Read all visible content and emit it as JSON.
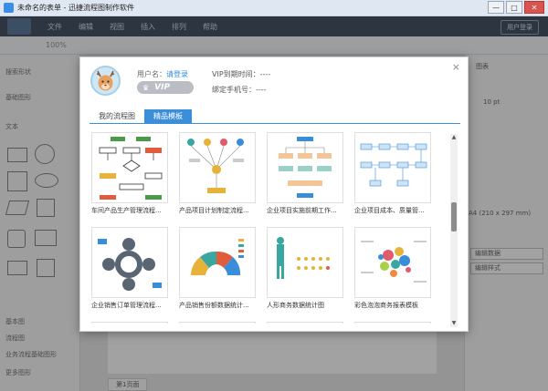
{
  "window": {
    "title": "未命名的表单 - 迅捷流程图制作软件",
    "minimize": "—",
    "maximize": "□",
    "close": "✕"
  },
  "menu": {
    "items": [
      "文件",
      "编辑",
      "视图",
      "插入",
      "排列",
      "帮助"
    ],
    "login_button": "用户登录"
  },
  "toolbar": {
    "zoom": "100%"
  },
  "left_panel": {
    "search_placeholder": "搜索形状",
    "section_basic": "基础图形",
    "text_label": "文本",
    "section_more": [
      "基本图",
      "流程图",
      "业务流程基础图形"
    ],
    "more_button": "更多图形"
  },
  "canvas": {
    "page_tab": "第1页面"
  },
  "right_panel": {
    "label_top": "图表",
    "size_text": "10 pt",
    "paper": "A4 (210 x 297 mm)",
    "btn1": "编辑数据",
    "btn2": "编辑样式"
  },
  "modal": {
    "close": "×",
    "username_label": "用户名：",
    "login_link": "请登录",
    "vip_badge": "VIP",
    "vip_expire": "VIP到期时间：----",
    "bind_phone": "绑定手机号：----",
    "tabs": [
      {
        "label": "我的流程图",
        "active": false
      },
      {
        "label": "精品模板",
        "active": true
      }
    ],
    "templates": [
      {
        "label": "车间产品生产管理流程..."
      },
      {
        "label": "产品项目计划制定流程..."
      },
      {
        "label": "企业项目实施前期工作..."
      },
      {
        "label": "企业项目成本、质量管..."
      },
      {
        "label": "企业销售订单管理流程..."
      },
      {
        "label": "产品销售份额数据统计..."
      },
      {
        "label": "人形商务数据统计图"
      },
      {
        "label": "彩色泡泡商务报表模板"
      }
    ]
  },
  "colors": {
    "accent": "#3b8fd9",
    "menubar": "#2f3e52",
    "vip_grey": "#b9bec4"
  }
}
